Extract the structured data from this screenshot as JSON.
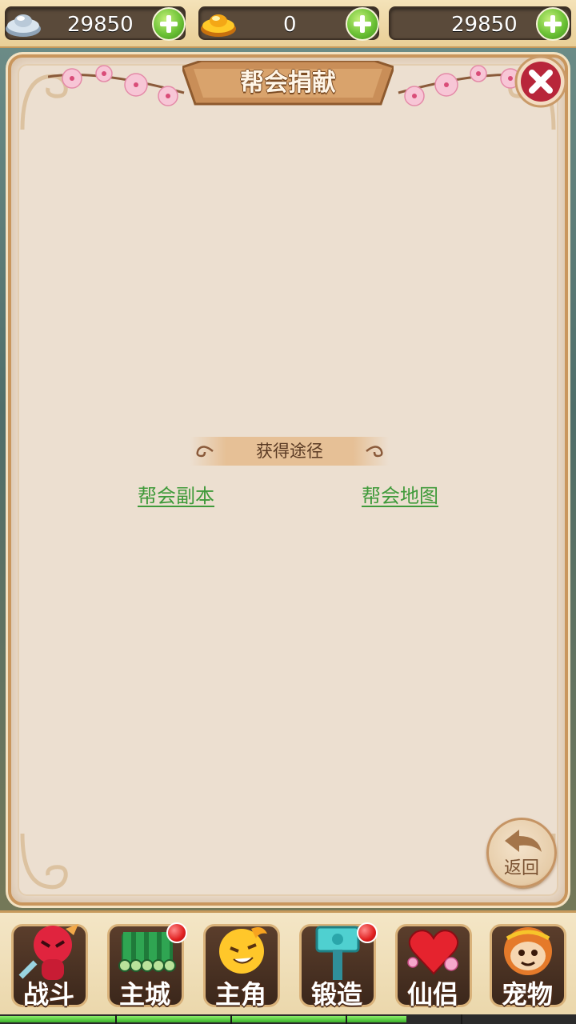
{
  "currencies": [
    {
      "icon": "silver-ingot-icon",
      "value": "29850"
    },
    {
      "icon": "gold-ingot-icon",
      "value": "0"
    },
    {
      "icon": "none",
      "value": "29850"
    }
  ],
  "dialog": {
    "title": "帮会捐献",
    "ways_title": "获得途径",
    "ways": [
      "帮会副本",
      "帮会地图"
    ],
    "back_label": "返回"
  },
  "nav": [
    {
      "label": "战斗",
      "icon": "red-warrior-icon",
      "badge": false
    },
    {
      "label": "主城",
      "icon": "bamboo-city-icon",
      "badge": true
    },
    {
      "label": "主角",
      "icon": "yellow-hero-icon",
      "badge": false
    },
    {
      "label": "锻造",
      "icon": "hammer-icon",
      "badge": true
    },
    {
      "label": "仙侣",
      "icon": "heart-flower-icon",
      "badge": false
    },
    {
      "label": "宠物",
      "icon": "monkey-pet-icon",
      "badge": false
    }
  ],
  "xp_progress": 0.705,
  "colors": {
    "link": "#3f9a3a",
    "panel": "#ecdfd0",
    "frame": "#c9965d"
  }
}
